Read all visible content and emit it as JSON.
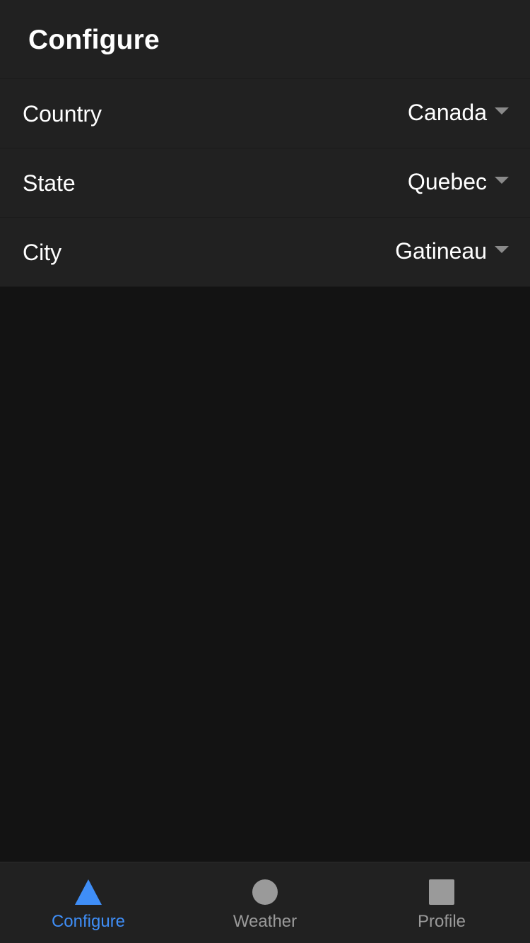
{
  "header": {
    "title": "Configure"
  },
  "settings": {
    "rows": [
      {
        "label": "Country",
        "value": "Canada"
      },
      {
        "label": "State",
        "value": "Quebec"
      },
      {
        "label": "City",
        "value": "Gatineau"
      }
    ]
  },
  "tabbar": {
    "active_color": "#3f8ef7",
    "inactive_color": "#9a9a9a",
    "tabs": [
      {
        "label": "Configure",
        "icon": "triangle-icon",
        "active": true
      },
      {
        "label": "Weather",
        "icon": "circle-icon",
        "active": false
      },
      {
        "label": "Profile",
        "icon": "square-icon",
        "active": false
      }
    ]
  }
}
